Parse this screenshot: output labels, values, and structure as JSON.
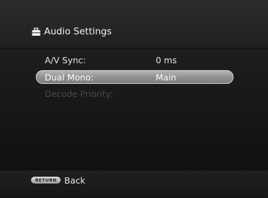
{
  "header": {
    "icon": "toolbox-icon",
    "title": "Audio Settings"
  },
  "menu": {
    "items": [
      {
        "label": "A/V Sync:",
        "value": "0 ms",
        "state": "normal"
      },
      {
        "label": "Dual Mono:",
        "value": "Main",
        "state": "selected"
      },
      {
        "label": "Decode Priority:",
        "value": "",
        "state": "disabled"
      }
    ]
  },
  "footer": {
    "return_button_label": "RETURN",
    "back_label": "Back"
  },
  "colors": {
    "selected_highlight": "#a6a6a6",
    "disabled_text": "#4a4a4a"
  }
}
